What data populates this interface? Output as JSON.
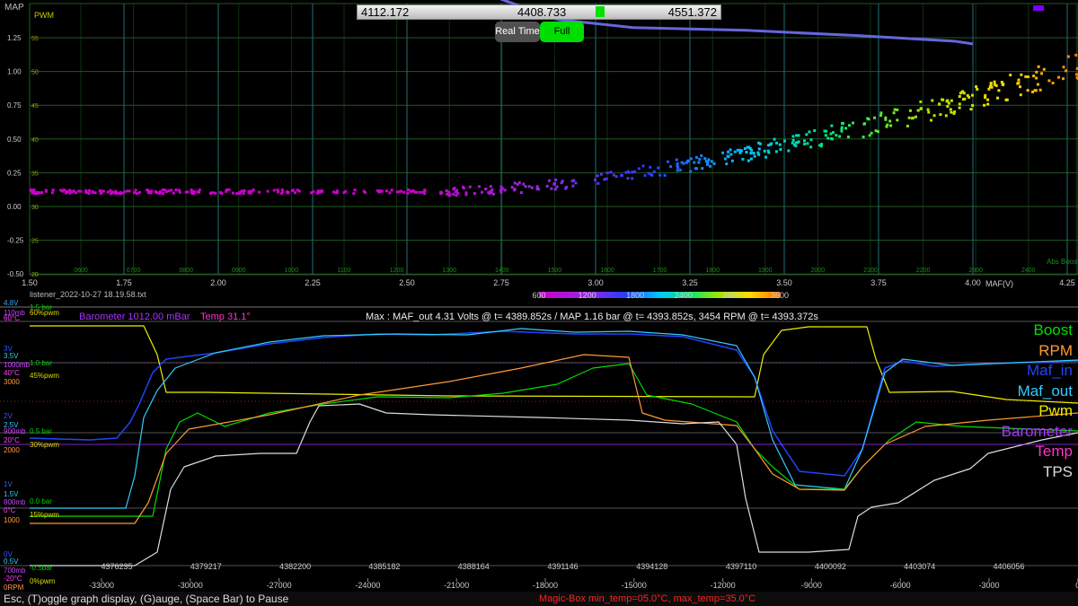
{
  "top_chart": {
    "map_label": "MAP",
    "pwm_label": "PWM",
    "map_ticks": [
      "1.25",
      "1.00",
      "0.75",
      "0.50",
      "0.25",
      "0.00",
      "-0.25",
      "-0.50"
    ],
    "pwm_ticks": [
      "55",
      "50",
      "45",
      "40",
      "35",
      "30",
      "25",
      "20"
    ],
    "maf_ticks": [
      "1.50",
      "1.75",
      "2.00",
      "2.25",
      "2.50",
      "2.75",
      "3.00",
      "3.25",
      "3.50",
      "3.75",
      "4.00",
      "4.25"
    ],
    "rpm_ticks": [
      "0600",
      "0700",
      "0800",
      "0900",
      "1000",
      "1100",
      "1200",
      "1300",
      "1400",
      "1500",
      "1600",
      "1700",
      "1800",
      "1900",
      "2000",
      "2100",
      "2200",
      "2300",
      "2400"
    ],
    "maf_unit": "MAF(V)",
    "abs_boost": "Abs Boost"
  },
  "slider": {
    "left": "4112.172",
    "center": "4408.733",
    "right": "4551.372"
  },
  "buttons": {
    "real_time": "Real Time",
    "full_speed": "Full Speed"
  },
  "filename": "listener_2022-10-27 18.19.58.txt",
  "colorbar": {
    "ticks": [
      "600",
      "1200",
      "1800",
      "2400",
      "3000",
      "3600"
    ]
  },
  "bottom_chart": {
    "info_barometer": "Barometer 1012.00 mBar",
    "info_temp": "Temp 31.1°",
    "info_max": "Max : MAF_out 4.31 Volts @ t= 4389.852s / MAP 1.16 bar @ t= 4393.852s, 3454 RPM @ t= 4393.372s",
    "axis_left": [
      {
        "t": "4.8V",
        "c": "#33aaff"
      },
      {
        "t": "1.5 bar",
        "c": "#00cc00"
      },
      {
        "t": "110mb",
        "c": "#cc44ff"
      },
      {
        "t": "60%pwm",
        "c": "#dddd00"
      },
      {
        "t": "60°C",
        "c": "#ff44ff"
      },
      {
        "t": "3V",
        "c": "#3355ff"
      },
      {
        "t": "3.5V",
        "c": "#33ccff"
      },
      {
        "t": "1000mb",
        "c": "#cc44ff"
      },
      {
        "t": "40°C",
        "c": "#ff44ff"
      },
      {
        "t": "1.0 bar",
        "c": "#00cc00"
      },
      {
        "t": "45%pwm",
        "c": "#dddd00"
      },
      {
        "t": "3000",
        "c": "#ff9944"
      },
      {
        "t": "2V",
        "c": "#3355ff"
      },
      {
        "t": "2.5V",
        "c": "#33ccff"
      },
      {
        "t": "900mb",
        "c": "#cc44ff"
      },
      {
        "t": "0.5 bar",
        "c": "#00cc00"
      },
      {
        "t": "20°C",
        "c": "#ff44ff"
      },
      {
        "t": "30%pwm",
        "c": "#dddd00"
      },
      {
        "t": "2000",
        "c": "#ff9944"
      },
      {
        "t": "1V",
        "c": "#3355ff"
      },
      {
        "t": "1.5V",
        "c": "#33ccff"
      },
      {
        "t": "800mb",
        "c": "#cc44ff"
      },
      {
        "t": "0.0 bar",
        "c": "#00cc00"
      },
      {
        "t": "0°C",
        "c": "#ff44ff"
      },
      {
        "t": "15%pwm",
        "c": "#dddd00"
      },
      {
        "t": "1000",
        "c": "#ff9944"
      },
      {
        "t": "0V",
        "c": "#3355ff"
      },
      {
        "t": "0.5V",
        "c": "#33ccff"
      },
      {
        "t": "-0.5bar",
        "c": "#00cc00"
      },
      {
        "t": "700mb",
        "c": "#cc44ff"
      },
      {
        "t": "-20°C",
        "c": "#ff44ff"
      },
      {
        "t": "0%pwm",
        "c": "#dddd00"
      },
      {
        "t": "0RPM",
        "c": "#ff9944"
      }
    ],
    "time_ticks": [
      "4376235",
      "4379217",
      "4382200",
      "4385182",
      "4388164",
      "4391146",
      "4394128",
      "4397110",
      "4400092",
      "4403074",
      "4406056"
    ],
    "rel_ticks": [
      "-33000",
      "-30000",
      "-27000",
      "-24000",
      "-21000",
      "-18000",
      "-15000",
      "-12000",
      "-9000",
      "-6000",
      "-3000",
      "0"
    ],
    "legend": [
      {
        "name": "Boost",
        "color": "#00dd00"
      },
      {
        "name": "RPM",
        "color": "#ff9933"
      },
      {
        "name": "Maf_in",
        "color": "#2244ff"
      },
      {
        "name": "Maf_out",
        "color": "#33ccff"
      },
      {
        "name": "Pwm",
        "color": "#eeee00"
      },
      {
        "name": "Barometer",
        "color": "#aa33ff"
      },
      {
        "name": "Temp",
        "color": "#ff33cc"
      },
      {
        "name": "TPS",
        "color": "#dddddd"
      }
    ]
  },
  "status": {
    "help": "Esc, (T)oggle graph display, (G)auge, (Space Bar) to Pause",
    "magic": "Magic-Box  min_temp=05.0°C, max_temp=35.0°C"
  },
  "colors": {
    "grid_green": "#1f5a1f",
    "grid_cyan": "#1f6f6f",
    "trend": "#6666dd"
  }
}
